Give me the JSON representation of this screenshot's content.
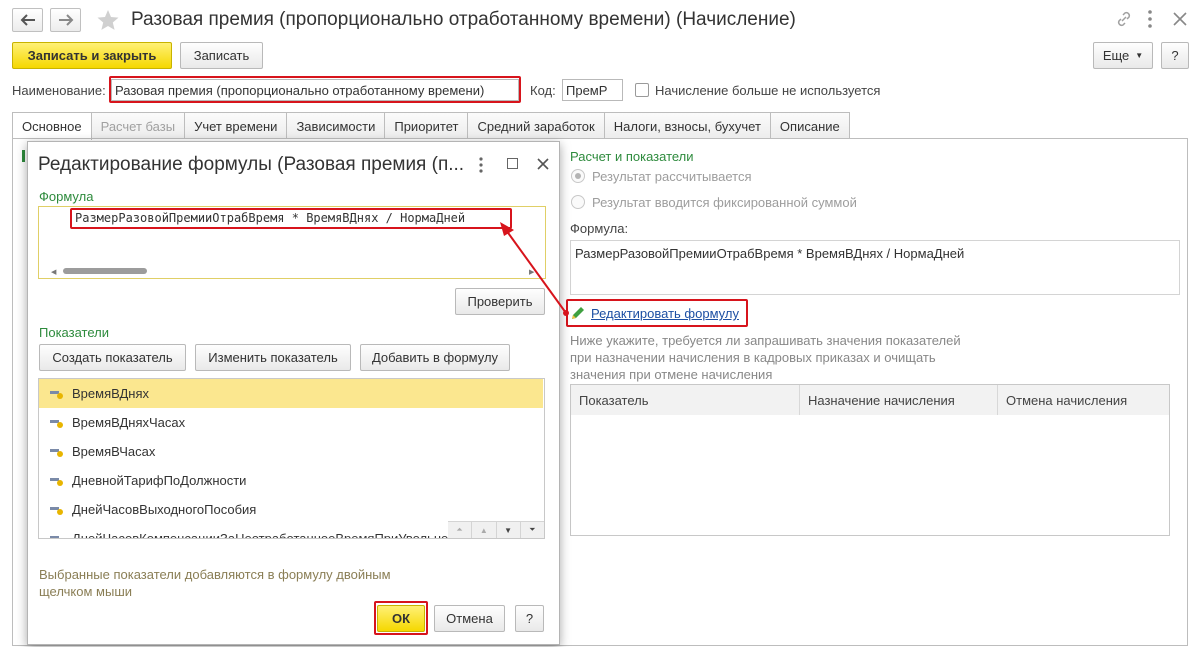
{
  "window": {
    "title": "Разовая премия (пропорционально отработанному времени) (Начисление)"
  },
  "toolbar": {
    "save_close_label": "Записать и закрыть",
    "save_label": "Записать",
    "more_label": "Еще",
    "help_label": "?"
  },
  "form": {
    "name_label": "Наименование:",
    "name_value": "Разовая премия (пропорционально отработанному времени)",
    "code_label": "Код:",
    "code_value": "ПремР",
    "not_used_label": "Начисление больше не используется"
  },
  "tabs": [
    {
      "label": "Основное"
    },
    {
      "label": "Расчет базы"
    },
    {
      "label": "Учет времени"
    },
    {
      "label": "Зависимости"
    },
    {
      "label": "Приоритет"
    },
    {
      "label": "Средний заработок"
    },
    {
      "label": "Налоги, взносы, бухучет"
    },
    {
      "label": "Описание"
    }
  ],
  "right": {
    "section_title": "Расчет и показатели",
    "radio1": "Результат рассчитывается",
    "radio2": "Результат вводится фиксированной суммой",
    "formula_label": "Формула:",
    "formula_value": "РазмерРазовойПремииОтрабВремя * ВремяВДнях / НормаДней",
    "edit_formula_link": "Редактировать формулу",
    "hint": [
      "Ниже укажите, требуется ли запрашивать значения показателей",
      "при назначении начисления в кадровых приказах и очищать",
      "значения при отмене начисления"
    ],
    "table_headers": [
      "Показатель",
      "Назначение начисления",
      "Отмена начисления"
    ]
  },
  "dialog": {
    "title": "Редактирование формулы (Разовая премия (п...",
    "formula_section": "Формула",
    "formula_text": "РазмерРазовойПремииОтрабВремя * ВремяВДнях / НормаДней",
    "check_label": "Проверить",
    "indicators_section": "Показатели",
    "create_label": "Создать показатель",
    "change_label": "Изменить показатель",
    "add_label": "Добавить в формулу",
    "indicators": [
      "ВремяВДнях",
      "ВремяВДняхЧасах",
      "ВремяВЧасах",
      "ДневнойТарифПоДолжности",
      "ДнейЧасовВыходногоПособия",
      "ДнейЧасовКомпенсацииЗаНеотработанноеВремяПриУвольнении"
    ],
    "hint": [
      "Выбранные показатели добавляются в формулу двойным",
      "щелчком мыши"
    ],
    "ok_label": "ОК",
    "cancel_label": "Отмена",
    "help_label": "?"
  },
  "colors": {
    "accent_yellow": "#f5d800",
    "annotation_red": "#d7141c",
    "section_green": "#2e8b3d",
    "selected_row": "#fbe78f",
    "link_blue": "#1c4fa3"
  }
}
